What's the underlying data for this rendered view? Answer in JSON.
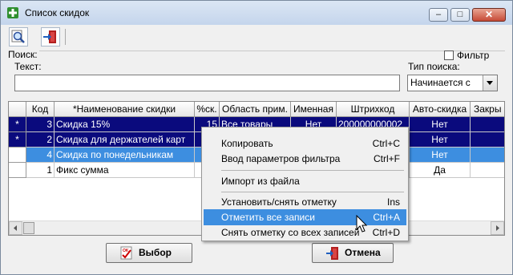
{
  "window": {
    "title": "Список скидок",
    "controls": {
      "minimize": "–",
      "maximize": "□",
      "close": "✕"
    }
  },
  "toolbar": {
    "icons": [
      "search-settings-icon",
      "exit-door-icon"
    ]
  },
  "filter_panel": {
    "search_label": "Поиск:",
    "filter_label": "Фильтр",
    "filter_checked": false,
    "text_label": "Текст:",
    "text_value": "",
    "search_type_label": "Тип поиска:",
    "search_type_value": "Начинается с"
  },
  "grid": {
    "columns": [
      "Код",
      "*Наименование скидки",
      "%ск.",
      "Область прим.",
      "Именная",
      "Штрихкод",
      "Авто-скидка",
      "Закры"
    ],
    "rows": [
      {
        "marker": "*",
        "code": "3",
        "name": "Скидка 15%",
        "percent": "15",
        "area": "Все товары",
        "named": "Нет",
        "barcode": "200000000002",
        "auto": "Нет",
        "closed": ""
      },
      {
        "marker": "*",
        "code": "2",
        "name": "Скидка для держателей карт",
        "percent": "",
        "area": "",
        "named": "",
        "barcode": "",
        "auto": "Нет",
        "closed": ""
      },
      {
        "marker": "",
        "code": "4",
        "name": "Скидка по понедельникам",
        "percent": "",
        "area": "",
        "named": "",
        "barcode": "",
        "auto": "Нет",
        "closed": ""
      },
      {
        "marker": "",
        "code": "1",
        "name": "Фикс сумма",
        "percent": "",
        "area": "",
        "named": "",
        "barcode": "",
        "auto": "Да",
        "closed": ""
      }
    ]
  },
  "context_menu": {
    "items": [
      {
        "label": "Копировать",
        "shortcut": "Ctrl+C"
      },
      {
        "label": "Ввод параметров фильтра",
        "shortcut": "Ctrl+F"
      },
      {
        "label": "Импорт из файла",
        "shortcut": ""
      },
      {
        "label": "Установить/снять отметку",
        "shortcut": "Ins"
      },
      {
        "label": "Отметить все записи",
        "shortcut": "Ctrl+A"
      },
      {
        "label": "Снять отметку со всех записей",
        "shortcut": "Ctrl+D"
      }
    ],
    "active_index": 4
  },
  "buttons": {
    "select": "Выбор",
    "cancel": "Отмена"
  },
  "colors": {
    "selected_row": "#0a0a7d",
    "highlight": "#3d8ee0"
  }
}
